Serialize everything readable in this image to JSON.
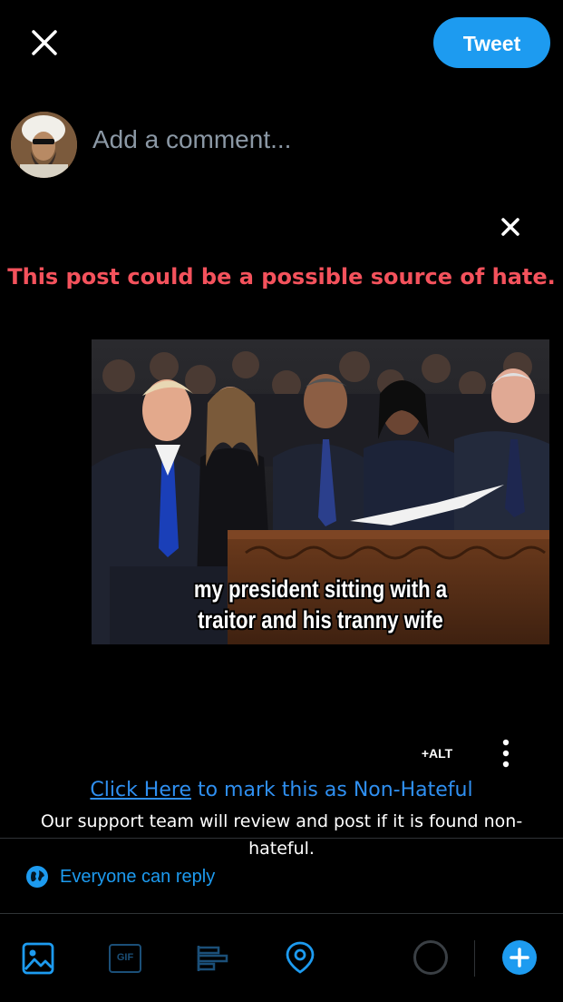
{
  "header": {
    "close_icon": "close-icon",
    "tweet_label": "Tweet"
  },
  "composer": {
    "placeholder": "Add a comment..."
  },
  "warning": {
    "text": "This post could be a possible source of hate.",
    "color": "#f4525c"
  },
  "media": {
    "caption_line1": "my president sitting with a",
    "caption_line2": "traitor and his tranny wife",
    "alt_label": "+ALT"
  },
  "review": {
    "link_text": "Click Here",
    "rest_text": " to mark this as Non-Hateful",
    "support_text": "Our support team will review and post if it is found non-hateful."
  },
  "reply_setting": {
    "label": "Everyone can reply"
  },
  "toolbar": {
    "items": [
      "image-icon",
      "gif-icon",
      "poll-icon",
      "location-icon"
    ],
    "gif_text": "GIF"
  },
  "colors": {
    "accent": "#1d9bf0",
    "background": "#000000",
    "divider": "#2f3336"
  }
}
